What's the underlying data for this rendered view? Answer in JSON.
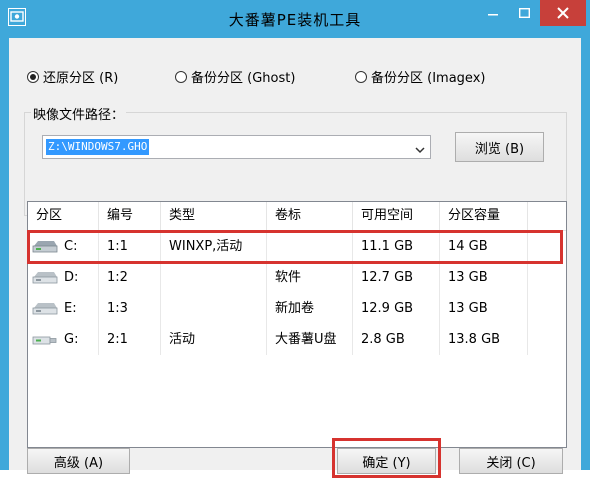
{
  "window": {
    "title": "大番薯PE装机工具",
    "accent": "#3fa8da",
    "close_color": "#c7403a",
    "highlight_color": "#d6332f"
  },
  "mode": {
    "options": [
      {
        "label": "还原分区 (R)",
        "checked": true
      },
      {
        "label": "备份分区 (Ghost)",
        "checked": false
      },
      {
        "label": "备份分区 (Imagex)",
        "checked": false
      }
    ]
  },
  "image": {
    "label": "映像文件路径：",
    "path": "Z:\\WINDOWS7.GHO",
    "browse_label": "浏览 (B)"
  },
  "table": {
    "columns": [
      "分区",
      "编号",
      "类型",
      "卷标",
      "可用空间",
      "分区容量"
    ],
    "rows": [
      {
        "drive": "C:",
        "num": "1:1",
        "type": "WINXP,活动",
        "label": "",
        "free": "11.1 GB",
        "size": "14 GB",
        "selected": true
      },
      {
        "drive": "D:",
        "num": "1:2",
        "type": "",
        "label": "软件",
        "free": "12.7 GB",
        "size": "13 GB",
        "selected": false
      },
      {
        "drive": "E:",
        "num": "1:3",
        "type": "",
        "label": "新加卷",
        "free": "12.9 GB",
        "size": "13 GB",
        "selected": false
      },
      {
        "drive": "G:",
        "num": "2:1",
        "type": "活动",
        "label": "大番薯U盘",
        "free": "2.8 GB",
        "size": "13.8 GB",
        "selected": false
      }
    ]
  },
  "buttons": {
    "advanced": "高级 (A)",
    "ok": "确定 (Y)",
    "close": "关闭 (C)"
  },
  "icons": {
    "app": "app-icon",
    "minimize": "minimize-icon",
    "maximize": "maximize-icon",
    "close": "close-icon",
    "dropdown": "chevron-down-icon",
    "drive": "hard-drive-icon"
  }
}
